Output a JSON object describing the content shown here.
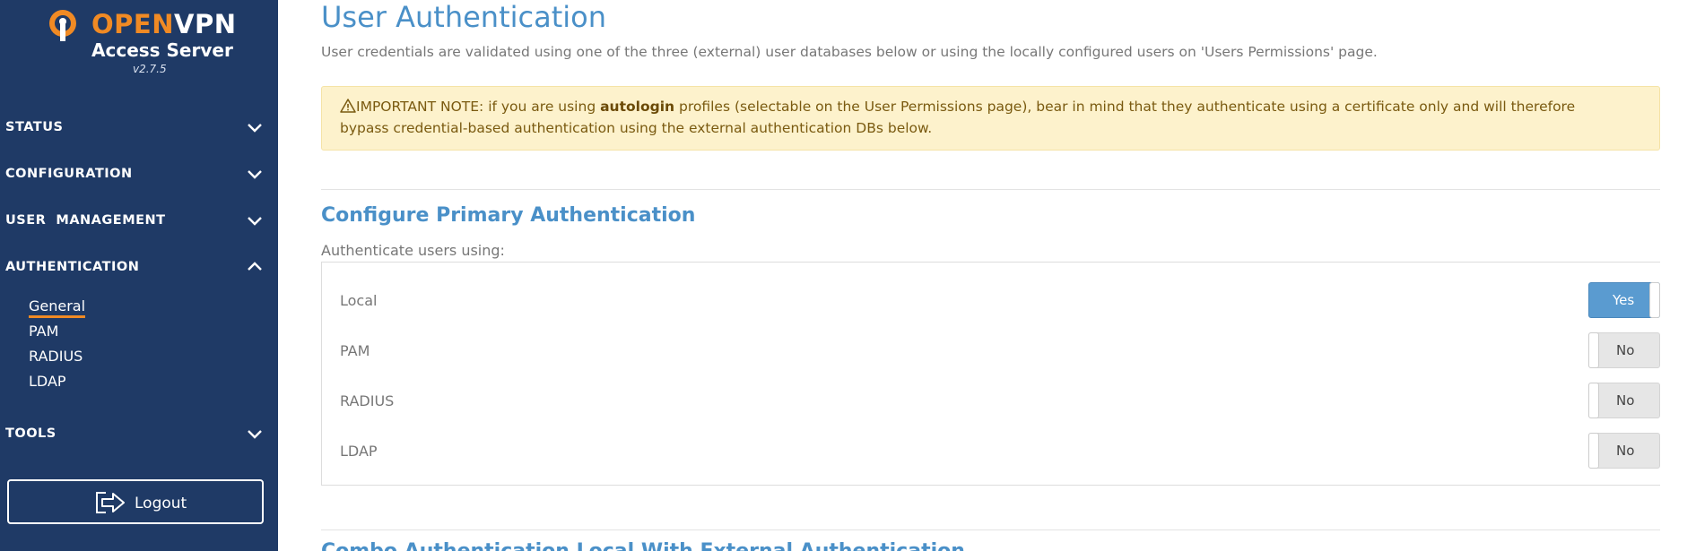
{
  "brand": {
    "name_part1": "OPEN",
    "name_part2": "VPN",
    "subtitle": "Access Server",
    "version": "v2.7.5",
    "logo_icon": "openvpn-keyhole-icon",
    "accent_color": "#f08a24",
    "sidebar_color": "#1f3a66"
  },
  "sidebar": {
    "sections": [
      {
        "label": "STATUS",
        "icon": "chevron-down-icon"
      },
      {
        "label": "CONFIGURATION",
        "icon": "chevron-down-icon"
      },
      {
        "label": "USER  MANAGEMENT",
        "icon": "chevron-down-icon"
      },
      {
        "label": "AUTHENTICATION",
        "icon": "chevron-up-icon"
      },
      {
        "label": "TOOLS",
        "icon": "chevron-down-icon"
      }
    ],
    "auth_subitems": [
      {
        "label": "General",
        "active": true
      },
      {
        "label": "PAM",
        "active": false
      },
      {
        "label": "RADIUS",
        "active": false
      },
      {
        "label": "LDAP",
        "active": false
      }
    ],
    "logout_label": "Logout",
    "logout_icon": "logout-arrow-icon"
  },
  "main": {
    "title": "User Authentication",
    "description": "User credentials are validated using one of the three (external) user databases below or using the locally configured users on 'Users Permissions' page.",
    "alert": {
      "icon": "warning-triangle-icon",
      "prefix": "IMPORTANT NOTE: if you are using ",
      "bold": "autologin",
      "suffix": " profiles (selectable on the User Permissions page), bear in mind that they authenticate using a certificate only and will therefore",
      "line2": "bypass credential-based authentication using the external authentication DBs below."
    },
    "section_title": "Configure Primary Authentication",
    "auth_label": "Authenticate users using:",
    "auth_methods": [
      {
        "name": "Local",
        "value": "Yes"
      },
      {
        "name": "PAM",
        "value": "No"
      },
      {
        "name": "RADIUS",
        "value": "No"
      },
      {
        "name": "LDAP",
        "value": "No"
      }
    ],
    "next_section_title": "Combo Authentication Local With External Authentication"
  }
}
